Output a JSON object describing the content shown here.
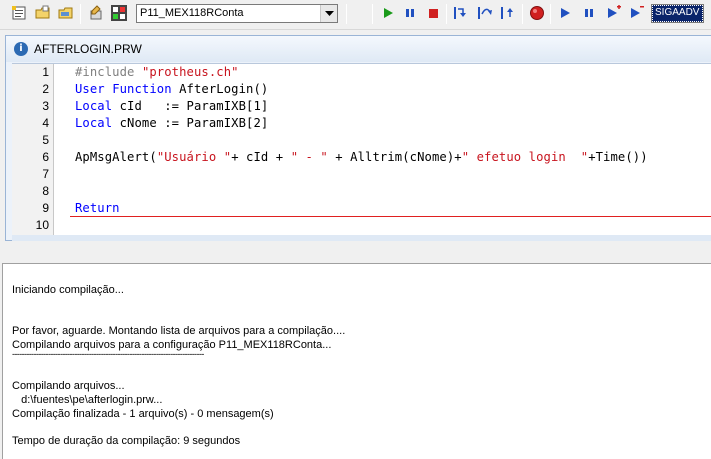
{
  "toolbar": {
    "left_icons": [
      "new-file-icon",
      "open-folder-icon",
      "open-project-icon",
      "wizard-icon",
      "compile-icon"
    ],
    "configuration_value": "P11_MEX118RConta",
    "debug_icons": [
      "run-icon",
      "pause-icon",
      "stop-icon",
      "step-into-icon",
      "step-over-icon",
      "step-out-icon",
      "breakpoint-icon",
      "run-to-cursor-icon",
      "pause-debug-icon",
      "step-plus-icon",
      "step-minus-icon"
    ],
    "environment_value": "SIGAADV",
    "colors": {
      "run": "#1a9a1a",
      "pause": "#2050c0",
      "stop": "#d02020",
      "breakpoint": "#d02020"
    }
  },
  "editor": {
    "tab_title": "AFTERLOGIN.PRW",
    "line_numbers": [
      "1",
      "2",
      "3",
      "4",
      "5",
      "6",
      "7",
      "8",
      "9",
      "10"
    ],
    "code": {
      "l1_directive": "#include",
      "l1_string": "\"protheus.ch\"",
      "l2_kw1": "User",
      "l2_kw2": "Function",
      "l2_rest": " AfterLogin()",
      "l3_kw": "Local",
      "l3_rest": " cId   := ParamIXB[1]",
      "l4_kw": "Local",
      "l4_rest": " cNome := ParamIXB[2]",
      "l6_a": "ApMsgAlert(",
      "l6_s1": "\"Usuário \"",
      "l6_b": "+ cId + ",
      "l6_s2": "\" - \"",
      "l6_c": " + Alltrim(cNome)+",
      "l6_s3": "\" efetuo login  \"",
      "l6_d": "+Time())",
      "l9_kw": "Return"
    },
    "colors": {
      "keyword": "#0000ff",
      "string": "#c8141e",
      "directive": "#808080",
      "function_separator": "#e02020"
    }
  },
  "output": {
    "lines": [
      "Iniciando compilação...",
      "",
      "Por favor, aguarde. Montando lista de arquivos para a compilação....",
      "Compilando arquivos para a configuração P11_MEX118RConta...",
      "--------------------------------------------------------------------------------",
      "",
      "Compilando arquivos...",
      "   d:\\fuentes\\pe\\afterlogin.prw...",
      "Compilação finalizada - 1 arquivo(s) - 0 mensagem(s)",
      "",
      "Tempo de duração da compilação: 9 segundos"
    ]
  }
}
